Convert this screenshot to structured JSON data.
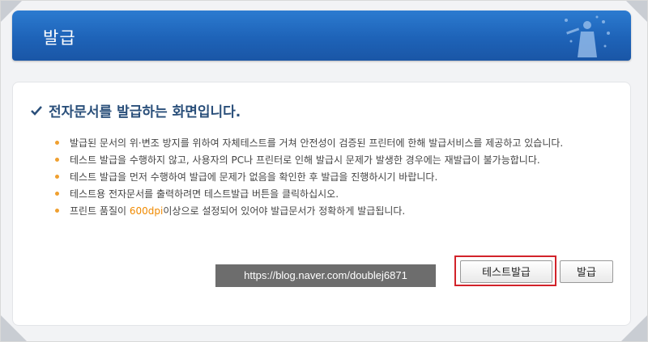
{
  "header": {
    "title": "발급"
  },
  "main": {
    "heading": "전자문서를 발급하는 화면입니다.",
    "notes": [
      {
        "text": "발급된 문서의 위·변조 방지를 위하여 자체테스트를 거쳐 안전성이 검증된 프린터에 한해 발급서비스를 제공하고 있습니다."
      },
      {
        "text": "테스트 발급을 수행하지 않고, 사용자의 PC나 프린터로 인해 발급시 문제가 발생한 경우에는 재발급이 불가능합니다."
      },
      {
        "text": "테스트 발급을 먼저 수행하여 발급에 문제가 없음을 확인한 후 발급을 진행하시기 바랍니다."
      },
      {
        "text": "테스트용 전자문서를 출력하려면 테스트발급 버튼을 클릭하십시오."
      },
      {
        "prefix": "프린트 품질이 ",
        "highlight": "600dpi",
        "suffix": "이상으로 설정되어 있어야 발급문서가 정확하게 발급됩니다."
      }
    ],
    "watermark": "https://blog.naver.com/doublej6871",
    "buttons": {
      "test_issue": "테스트발급",
      "issue": "발급"
    }
  },
  "colors": {
    "header_blue": "#1e63b8",
    "bullet": "#f0a030",
    "highlight_text": "#f08a00",
    "focus_box": "#d2232a"
  }
}
